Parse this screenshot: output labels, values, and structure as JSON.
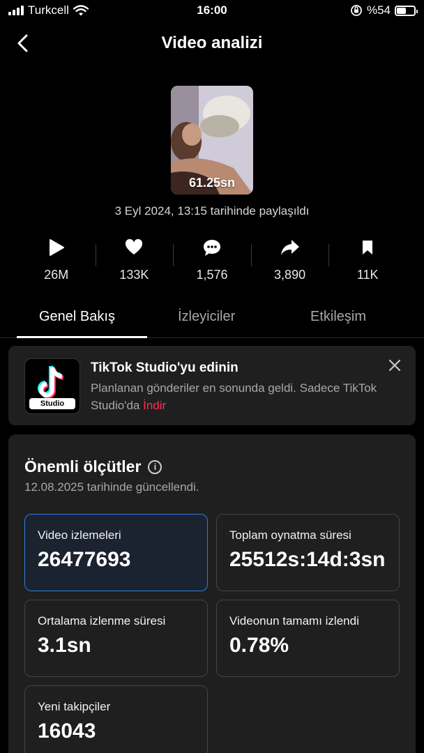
{
  "status_bar": {
    "carrier": "Turkcell",
    "time": "16:00",
    "battery": "%54",
    "battery_fraction": 0.54
  },
  "header": {
    "title": "Video analizi"
  },
  "video": {
    "duration": "61.25sn",
    "posted": "3 Eyl 2024, 13:15 tarihinde paylaşıldı"
  },
  "stats": [
    {
      "icon": "play-icon",
      "value": "26M"
    },
    {
      "icon": "heart-icon",
      "value": "133K"
    },
    {
      "icon": "comment-icon",
      "value": "1,576"
    },
    {
      "icon": "share-icon",
      "value": "3,890"
    },
    {
      "icon": "bookmark-icon",
      "value": "11K"
    }
  ],
  "tabs": [
    {
      "label": "Genel Bakış",
      "active": true
    },
    {
      "label": "İzleyiciler",
      "active": false
    },
    {
      "label": "Etkileşim",
      "active": false
    }
  ],
  "promo": {
    "logo_label": "Studio",
    "title": "TikTok Studio'yu edinin",
    "description": "Planlanan gönderiler en sonunda geldi. Sadece TikTok Studio'da ",
    "link": "İndir"
  },
  "metrics": {
    "title": "Önemli ölçütler",
    "updated": "12.08.2025 tarihinde güncellendi.",
    "items": [
      {
        "label": "Video izlemeleri",
        "value": "26477693"
      },
      {
        "label": "Toplam oynatma süresi",
        "value": "25512s:14d:3sn"
      },
      {
        "label": "Ortalama izlenme süresi",
        "value": "3.1sn"
      },
      {
        "label": "Videonun tamamı izlendi",
        "value": "0.78%"
      },
      {
        "label": "Yeni takipçiler",
        "value": "16043"
      }
    ]
  },
  "colors": {
    "background": "#000000",
    "card": "#1f1f1f",
    "accent_link": "#fe2c55",
    "active_border": "#2f7fd8"
  }
}
